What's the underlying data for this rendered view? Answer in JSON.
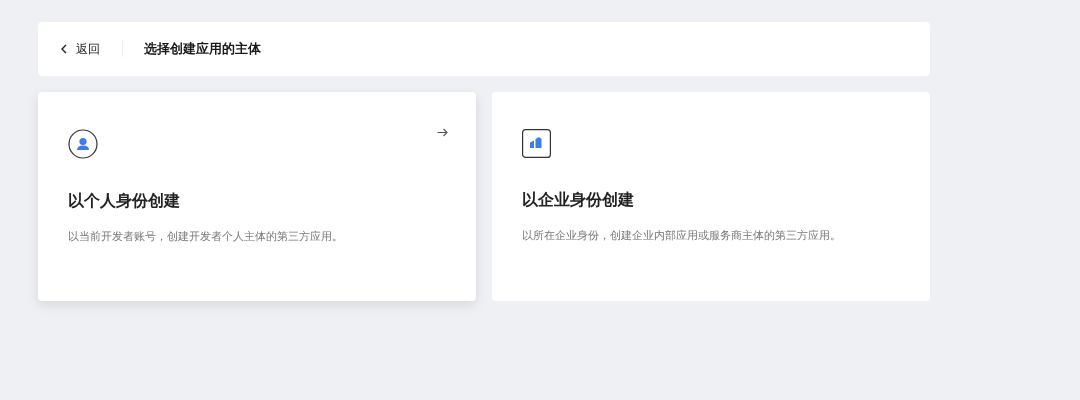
{
  "header": {
    "back": "返回",
    "title": "选择创建应用的主体"
  },
  "cards": [
    {
      "kind": "person",
      "title": "以个人身份创建",
      "description": "以当前开发者账号，创建开发者个人主体的第三方应用。",
      "selected": true
    },
    {
      "kind": "enterprise",
      "title": "以企业身份创建",
      "description": "以所在企业身份，创建企业内部应用或服务商主体的第三方应用。",
      "selected": false
    }
  ]
}
